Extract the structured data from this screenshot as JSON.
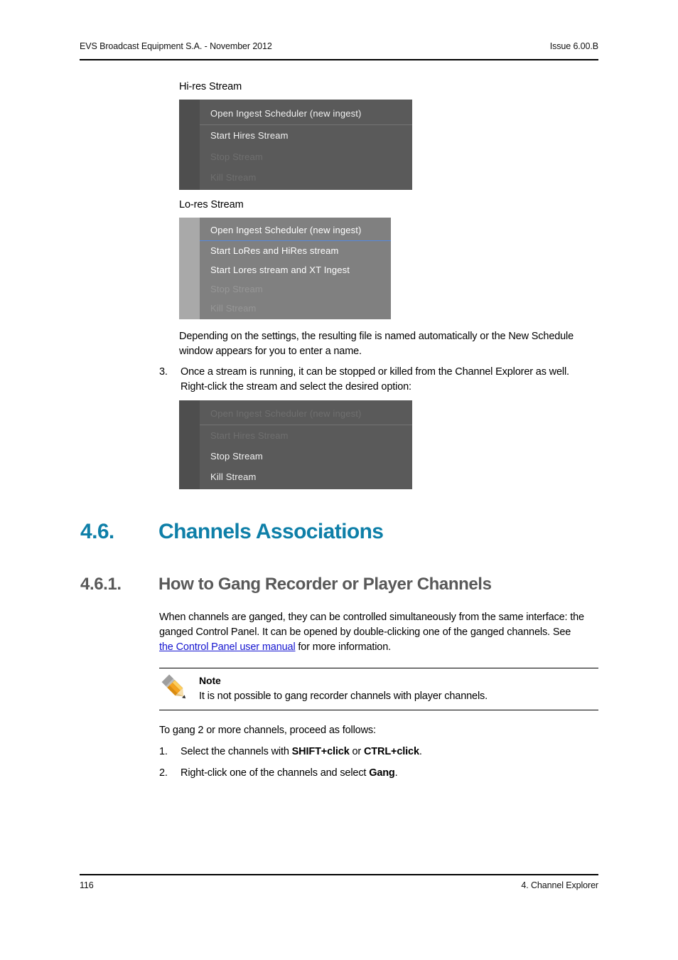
{
  "header": {
    "left": "EVS Broadcast Equipment S.A.  - November 2012",
    "right": "Issue 6.00.B"
  },
  "footer": {
    "page_number": "116",
    "chapter": "4. Channel Explorer"
  },
  "captions": {
    "hires": "Hi-res Stream",
    "lores": "Lo-res Stream"
  },
  "menus": {
    "hires": {
      "items": [
        {
          "label": "Open Ingest Scheduler (new ingest)",
          "state": "enabled"
        },
        {
          "label": "Start Hires Stream",
          "state": "enabled"
        },
        {
          "label": "Stop Stream",
          "state": "disabled"
        },
        {
          "label": "Kill Stream",
          "state": "disabled"
        }
      ]
    },
    "lores": {
      "items": [
        {
          "label": "Open Ingest Scheduler (new ingest)",
          "state": "enabled"
        },
        {
          "label": "Start LoRes and HiRes stream",
          "state": "enabled"
        },
        {
          "label": "Start Lores stream and XT Ingest",
          "state": "enabled"
        },
        {
          "label": "Stop Stream",
          "state": "disabled"
        },
        {
          "label": "Kill Stream",
          "state": "disabled"
        }
      ]
    },
    "running": {
      "items": [
        {
          "label": "Open Ingest Scheduler (new ingest)",
          "state": "disabled"
        },
        {
          "label": "Start Hires Stream",
          "state": "disabled"
        },
        {
          "label": "Stop Stream",
          "state": "enabled"
        },
        {
          "label": "Kill Stream",
          "state": "enabled"
        }
      ]
    }
  },
  "paragraphs": {
    "naming": "Depending on the settings, the resulting file is named automatically or the New Schedule window appears for you to enter a name.",
    "step3_num": "3.",
    "step3": "Once a stream is running, it can be stopped or killed from the Channel Explorer as well. Right-click the stream and select the desired option:",
    "gang_intro_1": "When channels are ganged, they can be controlled simultaneously from the same interface: the ganged Control Panel. It can be opened by double-clicking one of the ganged channels. See ",
    "gang_link": "the Control Panel user manual",
    "gang_intro_2": " for more information.",
    "gang_lead": "To gang 2 or more channels, proceed as follows:"
  },
  "headings": {
    "h1_number": "4.6.",
    "h1_title": "Channels Associations",
    "h2_number": "4.6.1.",
    "h2_title": "How to Gang Recorder or Player Channels"
  },
  "note": {
    "title": "Note",
    "text": "It is not possible to gang recorder channels with player channels."
  },
  "steps": [
    {
      "num": "1.",
      "pre": "Select the channels with ",
      "bold1": "SHIFT+click",
      "mid": " or ",
      "bold2": "CTRL+click",
      "post": "."
    },
    {
      "num": "2.",
      "pre": "Right-click one of the channels and select ",
      "bold1": "Gang",
      "mid": "",
      "bold2": "",
      "post": "."
    }
  ],
  "colors": {
    "heading_primary": "#0e7fa8",
    "heading_secondary": "#595959",
    "link": "#1616d0",
    "menu_dark_bg": "#5a5a5a",
    "menu_dark_gutter": "#4e4e4e",
    "menu_light_bg": "#808080",
    "menu_light_gutter": "#a9a9a9",
    "menu_separator_blue": "#5588dd"
  }
}
